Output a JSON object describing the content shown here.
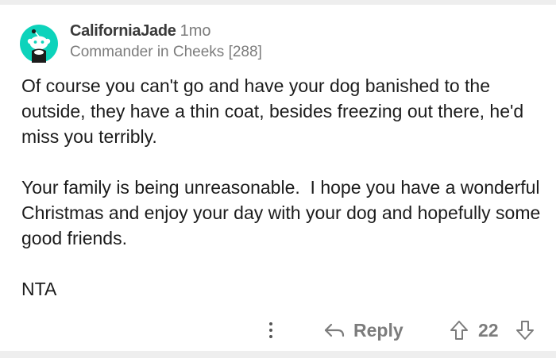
{
  "comment": {
    "author": "CaliforniaJade",
    "time": "1mo",
    "flair": "Commander in Cheeks [288]",
    "paragraphs": [
      "Of course you can't go and have your dog banished to the outside, they have a thin coat, besides freezing out there, he'd miss you terribly.",
      "Your family is being unreasonable.  I hope you have a wonderful Christmas and enjoy your day with your dog and hopefully some good friends.",
      "NTA"
    ]
  },
  "actions": {
    "more_icon": "more-vertical-icon",
    "reply_icon": "reply-arrow-icon",
    "reply_label": "Reply",
    "upvote_icon": "upvote-arrow-icon",
    "score": "22",
    "downvote_icon": "downvote-arrow-icon"
  },
  "colors": {
    "avatar": "#0dd3bb",
    "meta_text": "#7c7c7c",
    "body_text": "#1c1c1c",
    "frame": "#eeeeee"
  }
}
